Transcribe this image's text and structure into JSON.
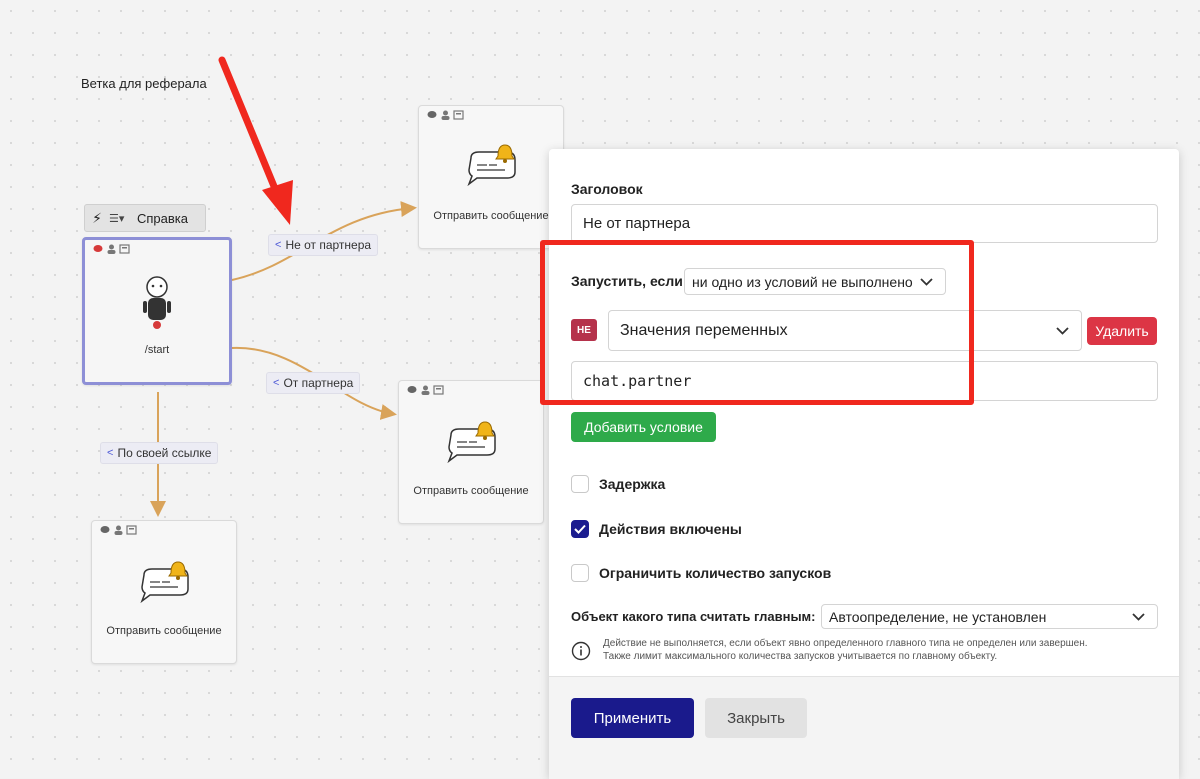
{
  "canvas": {
    "branch_title": "Ветка для реферала",
    "toolbar": {
      "bolt_icon": "lightning-icon",
      "menu_icon": "list-menu-icon",
      "help_label": "Справка"
    },
    "nodes": [
      {
        "id": "start",
        "label": "/start"
      },
      {
        "id": "msg1",
        "label": "Отправить сообщение"
      },
      {
        "id": "msg2",
        "label": "Отправить сообщение"
      },
      {
        "id": "msg3",
        "label": "Отправить сообщение"
      }
    ],
    "edge_labels": {
      "not_partner": "Не от партнера",
      "partner": "От партнера",
      "own_link": "По своей ссылке"
    }
  },
  "modal": {
    "title_label": "Заголовок",
    "title_value": "Не от партнера",
    "run_if_label": "Запустить, если",
    "run_if_value": "ни одно из условий не выполнено",
    "not_badge": "НЕ",
    "condition_type": "Значения переменных",
    "delete_label": "Удалить",
    "variable_value": "chat.partner",
    "add_condition_label": "Добавить условие",
    "delay_label": "Задержка",
    "delay_checked": false,
    "actions_enabled_label": "Действия включены",
    "actions_enabled_checked": true,
    "limit_label": "Ограничить количество запусков",
    "limit_checked": false,
    "main_type_label": "Объект какого типа считать главным:",
    "main_type_value": "Автоопределение, не установлен",
    "info_line1": "Действие не выполняется, если объект явно определенного главного типа не определен или завершен.",
    "info_line2": "Также лимит максимального количества запусков учитывается по главному объекту.",
    "apply_label": "Применить",
    "close_label": "Закрыть"
  },
  "colors": {
    "highlight": "#f0281e",
    "primary": "#1a1a8c",
    "success": "#2eaa4a",
    "danger": "#dc3545",
    "edge": "#d9a35a"
  }
}
